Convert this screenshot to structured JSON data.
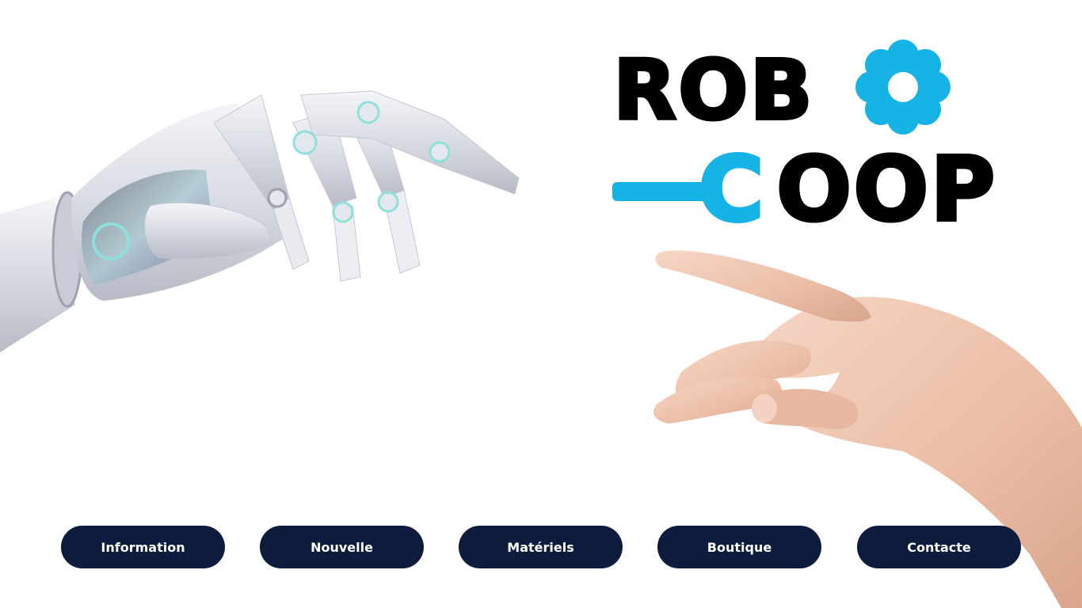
{
  "logo": {
    "line1": "ROB",
    "line2_c": "C",
    "line2_rest": "OOP",
    "accent_color": "#16b3e6",
    "text_color": "#000000"
  },
  "images": {
    "robot_hand": "robot-hand-image",
    "human_hand": "human-hand-image"
  },
  "nav": {
    "button_color": "#0d1b3d",
    "items": [
      {
        "label": "Information"
      },
      {
        "label": "Nouvelle"
      },
      {
        "label": "Matériels"
      },
      {
        "label": "Boutique"
      },
      {
        "label": "Contacte"
      }
    ]
  }
}
